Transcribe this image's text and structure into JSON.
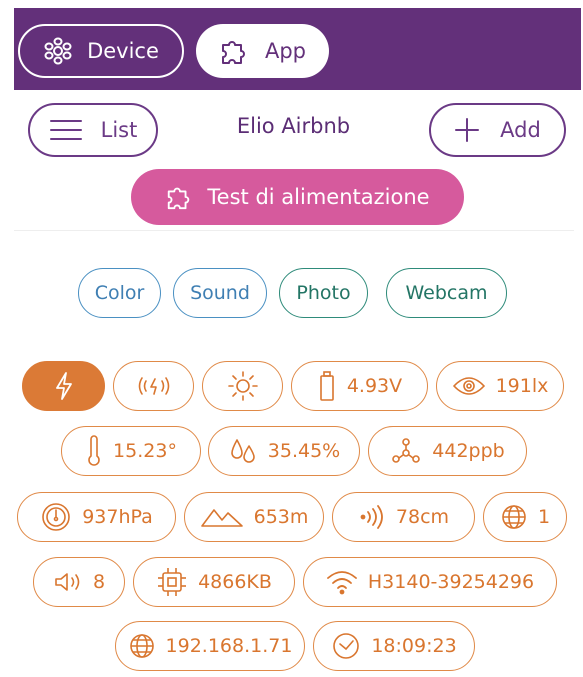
{
  "topbar": {
    "tabs": [
      {
        "label": "Device",
        "icon": "device-icon"
      },
      {
        "label": "App",
        "icon": "puzzle-icon"
      }
    ]
  },
  "header": {
    "list_label": "List",
    "title": "Elio Airbnb",
    "add_label": "Add",
    "test_label": "Test di alimentazione"
  },
  "filters": {
    "color": "Color",
    "sound": "Sound",
    "photo": "Photo",
    "webcam": "Webcam"
  },
  "sensors": {
    "battery": "4.93V",
    "light": "191lx",
    "temperature": "15.23°",
    "humidity": "35.45%",
    "air_quality": "442ppb",
    "pressure": "937hPa",
    "altitude": "653m",
    "distance": "78cm",
    "globe_count": "1",
    "volume": "8",
    "memory": "4866KB",
    "wifi": "H3140-39254296",
    "ip": "192.168.1.71",
    "time": "18:09:23"
  },
  "colors": {
    "purple": "#63307a",
    "pink": "#d65a9d",
    "orange": "#db7a36",
    "blue": "#4a90c2",
    "teal": "#2e8b7a"
  }
}
